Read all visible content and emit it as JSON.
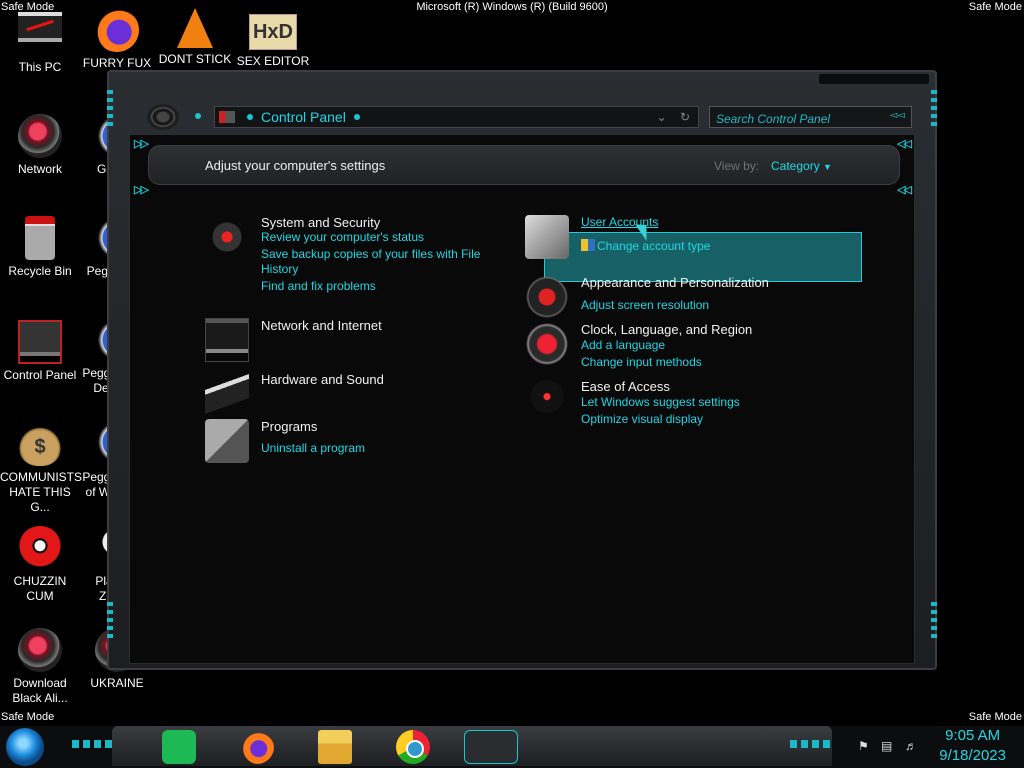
{
  "safe_mode": "Safe Mode",
  "build": "Microsoft (R) Windows (R) (Build 9600)",
  "desktop": {
    "icons": [
      {
        "label": "This PC"
      },
      {
        "label": "FURRY FUX"
      },
      {
        "label": "DONT STICK"
      },
      {
        "label": "SEX EDITOR"
      },
      {
        "label": "Network"
      },
      {
        "label": "Recycle Bin"
      },
      {
        "label": "Control Panel"
      },
      {
        "label": "COMMUNISTS HATE THIS G..."
      },
      {
        "label": "CHUZZIN CUM"
      },
      {
        "label": "Download Black Ali..."
      },
      {
        "label": "UKRAINE"
      }
    ],
    "partial": [
      "Go Chr",
      "Peggl",
      "Peggle De",
      "Peggle of Wa",
      "Plar Zo"
    ],
    "hxd_glyph": "HxD",
    "bag_glyph": "$"
  },
  "window": {
    "breadcrumb": "Control Panel",
    "search_placeholder": "Search Control Panel",
    "heading": "Adjust your computer's settings",
    "view_by_label": "View by:",
    "view_by_value": "Category",
    "left_categories": [
      {
        "title": "System and Security",
        "links": [
          "Review your computer's status",
          "Save backup copies of your files with File History",
          "Find and fix problems"
        ]
      },
      {
        "title": "Network and Internet",
        "links": []
      },
      {
        "title": "Hardware and Sound",
        "links": []
      },
      {
        "title": "Programs",
        "links": [
          "Uninstall a program"
        ]
      }
    ],
    "right_categories": [
      {
        "title": "User Accounts",
        "links": [
          "Change account type"
        ]
      },
      {
        "title": "Appearance and Personalization",
        "links": [
          "Adjust screen resolution"
        ]
      },
      {
        "title": "Clock, Language, and Region",
        "links": [
          "Add a language",
          "Change input methods"
        ]
      },
      {
        "title": "Ease of Access",
        "links": [
          "Let Windows suggest settings",
          "Optimize visual display"
        ]
      }
    ]
  },
  "taskbar": {
    "time": "9:05 AM",
    "date": "9/18/2023"
  },
  "colors": {
    "accent": "#1fd7e5"
  }
}
